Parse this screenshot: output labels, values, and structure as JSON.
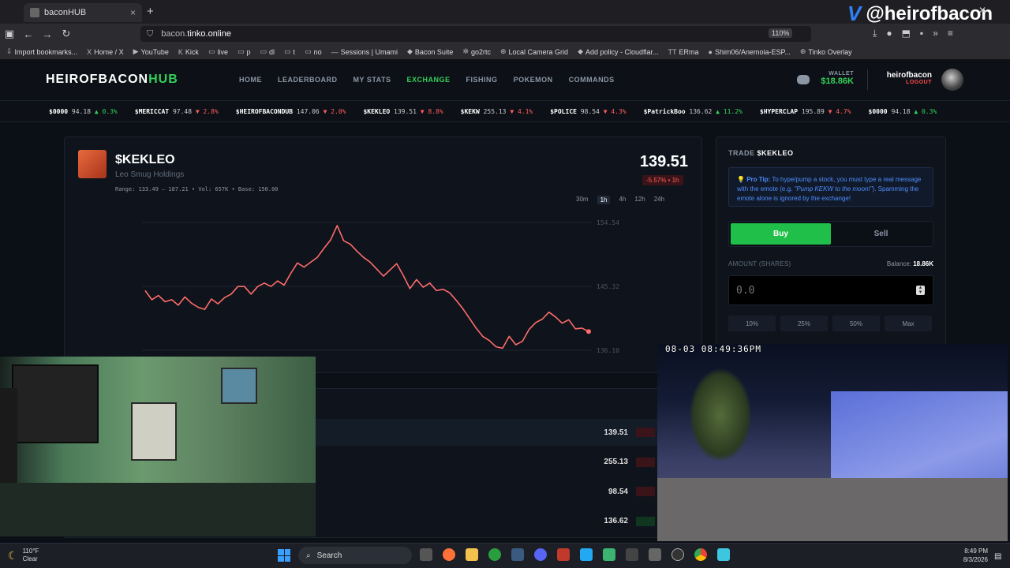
{
  "browser": {
    "tab_title": "baconHUB",
    "tab_close": "×",
    "new_tab": "+",
    "url_prefix": "bacon.",
    "url_host": "tinko.online",
    "zoom": "110%",
    "brand_handle": "@heirofbacon",
    "brand_v": "V",
    "close_window": "✕",
    "bookmarks": [
      {
        "icon": "⇩",
        "label": "Import bookmarks..."
      },
      {
        "icon": "X",
        "label": "Home / X"
      },
      {
        "icon": "▶",
        "label": "YouTube"
      },
      {
        "icon": "K",
        "label": "Kick"
      },
      {
        "icon": "▭",
        "label": "live"
      },
      {
        "icon": "▭",
        "label": "p"
      },
      {
        "icon": "▭",
        "label": "dl"
      },
      {
        "icon": "▭",
        "label": "t"
      },
      {
        "icon": "▭",
        "label": "no"
      },
      {
        "icon": "—",
        "label": "Sessions | Umami"
      },
      {
        "icon": "◆",
        "label": "Bacon Suite"
      },
      {
        "icon": "✲",
        "label": "go2rtc"
      },
      {
        "icon": "⊕",
        "label": "Local Camera Grid"
      },
      {
        "icon": "◆",
        "label": "Add policy - Cloudflar..."
      },
      {
        "icon": "TT",
        "label": "ERma"
      },
      {
        "icon": "●",
        "label": "Shim06/Anemoia-ESP..."
      },
      {
        "icon": "⊕",
        "label": "Tinko Overlay"
      }
    ]
  },
  "site": {
    "logo_main": "HEIROFBACON",
    "logo_accent": "HUB",
    "nav": [
      "HOME",
      "LEADERBOARD",
      "MY STATS",
      "EXCHANGE",
      "FISHING",
      "POKEMON",
      "COMMANDS"
    ],
    "nav_active": "EXCHANGE",
    "wallet_label": "WALLET",
    "wallet_value": "$18.86K",
    "username": "heirofbacon",
    "logout": "LOGOUT"
  },
  "ticker": [
    {
      "sym": "$0000",
      "price": "94.18",
      "dir": "up",
      "chg": "▲ 0.3%"
    },
    {
      "sym": "$MERICCAT",
      "price": "97.48",
      "dir": "dn",
      "chg": "▼ 2.8%"
    },
    {
      "sym": "$HEIROFBACONDUB",
      "price": "147.06",
      "dir": "dn",
      "chg": "▼ 2.0%"
    },
    {
      "sym": "$KEKLEO",
      "price": "139.51",
      "dir": "dn",
      "chg": "▼ 8.8%"
    },
    {
      "sym": "$KEKW",
      "price": "255.13",
      "dir": "dn",
      "chg": "▼ 4.1%"
    },
    {
      "sym": "$POLICE",
      "price": "98.54",
      "dir": "dn",
      "chg": "▼ 4.3%"
    },
    {
      "sym": "$PatrickBoo",
      "price": "136.62",
      "dir": "up",
      "chg": "▲ 11.2%"
    },
    {
      "sym": "$HYPERCLAP",
      "price": "195.89",
      "dir": "dn",
      "chg": "▼ 4.7%"
    },
    {
      "sym": "$0000",
      "price": "94.18",
      "dir": "up",
      "chg": "▲ 0.3%"
    }
  ],
  "stock": {
    "symbol": "$KEKLEO",
    "name": "Leo Smug Holdings",
    "stats": "Range: 133.49 — 187.21  •  Vol: 657K  •  Base: 150.00",
    "price": "139.51",
    "change": "-5.57% • 1h",
    "timeframes": [
      "30m",
      "1h",
      "4h",
      "12h",
      "24h"
    ],
    "timeframe_selected": "1h"
  },
  "chart_data": {
    "type": "line",
    "yticks": [
      "154.54",
      "145.32",
      "136.10"
    ],
    "ylim": [
      136.1,
      154.54
    ],
    "color": "#ff6b6b",
    "values": [
      144.7,
      143.4,
      144.0,
      143.1,
      143.4,
      142.6,
      143.8,
      142.9,
      142.3,
      142.0,
      143.5,
      142.8,
      143.7,
      144.2,
      145.3,
      145.3,
      144.2,
      145.3,
      145.8,
      145.3,
      146.1,
      145.5,
      147.2,
      148.7,
      148.1,
      148.8,
      149.5,
      150.8,
      152.0,
      154.1,
      151.9,
      151.4,
      150.4,
      149.5,
      148.8,
      147.8,
      146.8,
      147.7,
      148.6,
      146.9,
      145.0,
      146.3,
      145.2,
      145.8,
      144.7,
      144.9,
      144.4,
      143.3,
      142.1,
      140.7,
      139.3,
      138.1,
      137.5,
      136.6,
      136.4,
      138.1,
      136.9,
      137.4,
      139.1,
      140.1,
      140.6,
      141.6,
      140.9,
      140.0,
      140.5,
      139.2,
      139.3,
      138.8
    ]
  },
  "trade": {
    "title_prefix": "TRADE",
    "title_symbol": "$KEKLEO",
    "tip_icon": "💡",
    "tip_label": "Pro Tip:",
    "tip_text": " To hype/pump a stock, you must type a real message with the emote (e.g. ",
    "tip_example": "\"Pump KEKW to the moon!\"",
    "tip_text2": "). Spamming the emote alone is ignored by the exchange!",
    "buy": "Buy",
    "sell": "Sell",
    "amount_label": "AMOUNT (SHARES)",
    "balance_label": "Balance:",
    "balance_value": "18.86K",
    "amount_placeholder": "0.0",
    "pcts": [
      "10%",
      "25%",
      "50%",
      "Max"
    ]
  },
  "market_rows": [
    {
      "price": "139.51",
      "dir": "dn"
    },
    {
      "price": "255.13",
      "dir": "dn"
    },
    {
      "price": "98.54",
      "dir": "dn"
    },
    {
      "price": "136.62",
      "dir": "up"
    }
  ],
  "camera": {
    "timestamp": "08-03 08:49:36PM"
  },
  "taskbar": {
    "temp": "110°F",
    "weather": "Clear",
    "search": "Search",
    "time": "8:49 PM",
    "date": "8/3/2026"
  }
}
